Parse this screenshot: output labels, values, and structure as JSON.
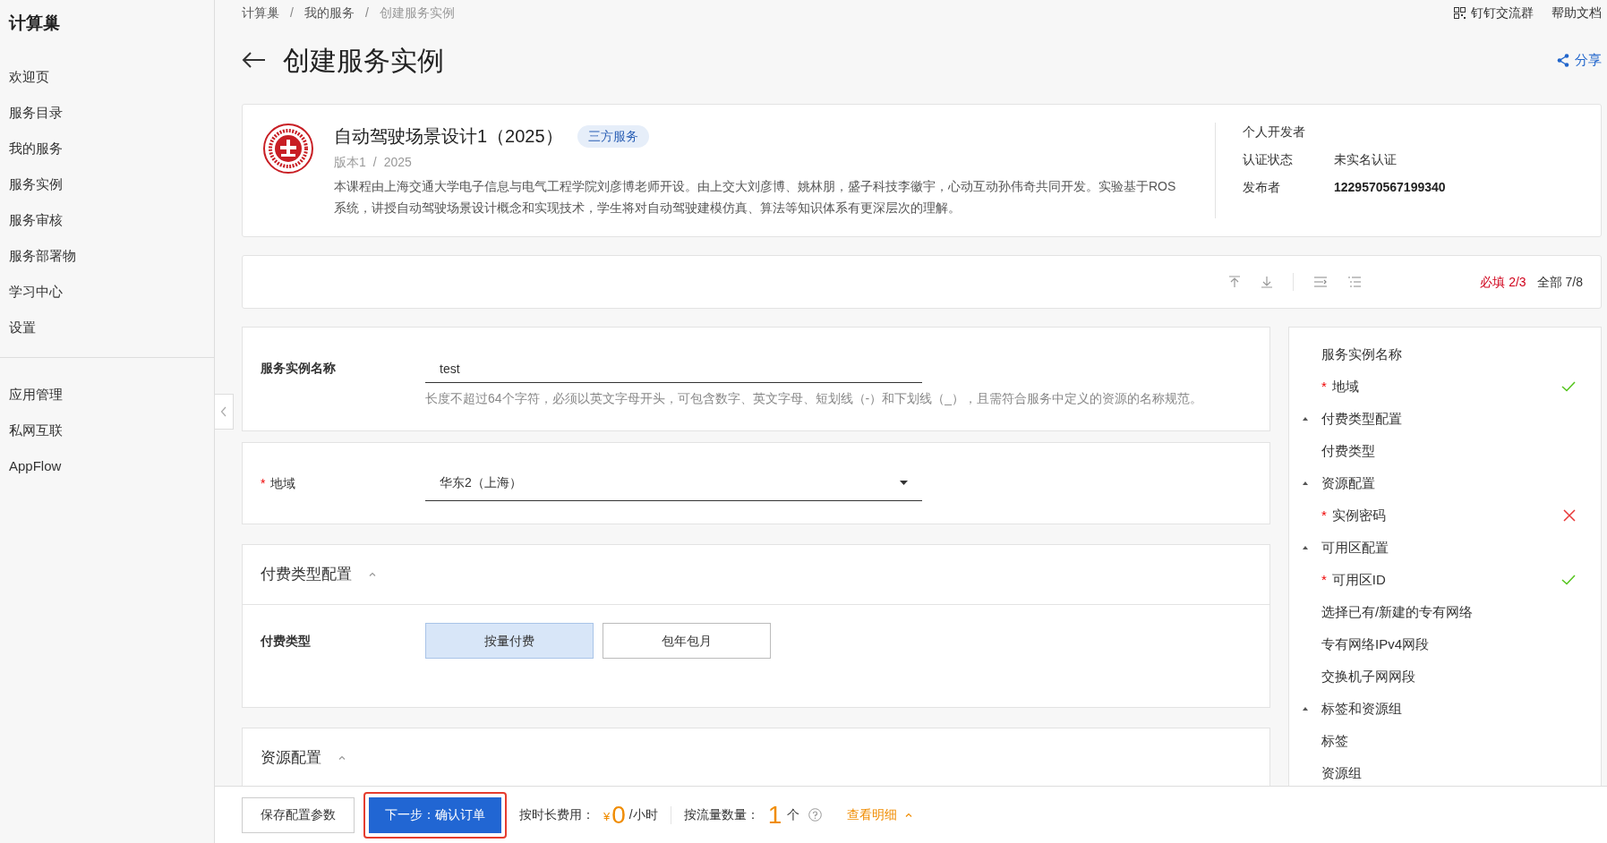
{
  "sidebar": {
    "title": "计算巢",
    "groups": [
      [
        "欢迎页",
        "服务目录",
        "我的服务",
        "服务实例",
        "服务审核",
        "服务部署物",
        "学习中心",
        "设置"
      ],
      [
        "应用管理",
        "私网互联",
        "AppFlow"
      ]
    ]
  },
  "required_mark": "*",
  "breadcrumb": {
    "separators": [
      "/",
      "/"
    ],
    "items": [
      "计算巢",
      "我的服务",
      "创建服务实例"
    ]
  },
  "header_links": [
    {
      "label": "钉钉交流群",
      "kind": "qr"
    },
    {
      "label": "帮助文档",
      "kind": "plain"
    }
  ],
  "page_title": "创建服务实例",
  "share": "分享",
  "service": {
    "name": "自动驾驶场景设计1（2025）",
    "tag": "三方服务",
    "version": "版本1",
    "separator": "/",
    "year": "2025",
    "description": "本课程由上海交通大学电子信息与电气工程学院刘彦博老师开设。由上交大刘彦博、姚林朋，盛子科技李徽宇，心动互动孙伟奇共同开发。实验基于ROS系统，讲授自动驾驶场景设计概念和实现技术，学生将对自动驾驶建模仿真、算法等知识体系有更深层次的理解。",
    "meta": [
      {
        "label": "个人开发者"
      },
      {
        "label": "认证状态",
        "value": "未实名认证"
      },
      {
        "label": "发布者",
        "value": "1229570567199340"
      }
    ]
  },
  "progress": [
    {
      "kind": "required",
      "text": "必填 2/3"
    },
    {
      "kind": "total",
      "text": "全部 7/8"
    }
  ],
  "form": {
    "instance_name": {
      "label": "服务实例名称",
      "value": "test",
      "help": "长度不超过64个字符，必须以英文字母开头，可包含数字、英文字母、短划线（-）和下划线（_），且需符合服务中定义的资源的名称规范。"
    },
    "region": {
      "label": "地域",
      "required": true,
      "value": "华东2（上海）"
    },
    "sections": [
      {
        "title": "付费类型配置",
        "expanded": true,
        "fields": [
          {
            "label": "付费类型",
            "options": [
              {
                "label": "按量付费",
                "selected": true
              },
              {
                "label": "包年包月",
                "selected": false
              }
            ]
          }
        ]
      },
      {
        "title": "资源配置",
        "expanded": true
      }
    ]
  },
  "nav": [
    {
      "label": "服务实例名称",
      "required": false
    },
    {
      "label": "地域",
      "required": true,
      "valid": true
    },
    {
      "label": "付费类型配置",
      "required": false,
      "expanded": true,
      "children": [
        {
          "label": "付费类型",
          "required": false
        }
      ]
    },
    {
      "label": "资源配置",
      "required": false,
      "expanded": true,
      "children": [
        {
          "label": "实例密码",
          "required": true,
          "valid": false
        }
      ]
    },
    {
      "label": "可用区配置",
      "required": false,
      "expanded": true,
      "children": [
        {
          "label": "可用区ID",
          "required": true,
          "valid": true
        },
        {
          "label": "选择已有/新建的专有网络",
          "required": false
        },
        {
          "label": "专有网络IPv4网段",
          "required": false
        },
        {
          "label": "交换机子网网段",
          "required": false
        }
      ]
    },
    {
      "label": "标签和资源组",
      "required": false,
      "expanded": true,
      "children": [
        {
          "label": "标签",
          "required": false
        },
        {
          "label": "资源组",
          "required": false
        }
      ]
    }
  ],
  "footer": {
    "save": "保存配置参数",
    "next": "下一步：确认订单",
    "highlighted": true,
    "hourly_label": "按时长费用：",
    "currency": "¥",
    "hourly_value": "0",
    "hourly_unit": "/小时",
    "count_label": "按流量数量：",
    "count_value": "1",
    "count_unit": "个",
    "details": "查看明细",
    "details_expanded": false
  }
}
